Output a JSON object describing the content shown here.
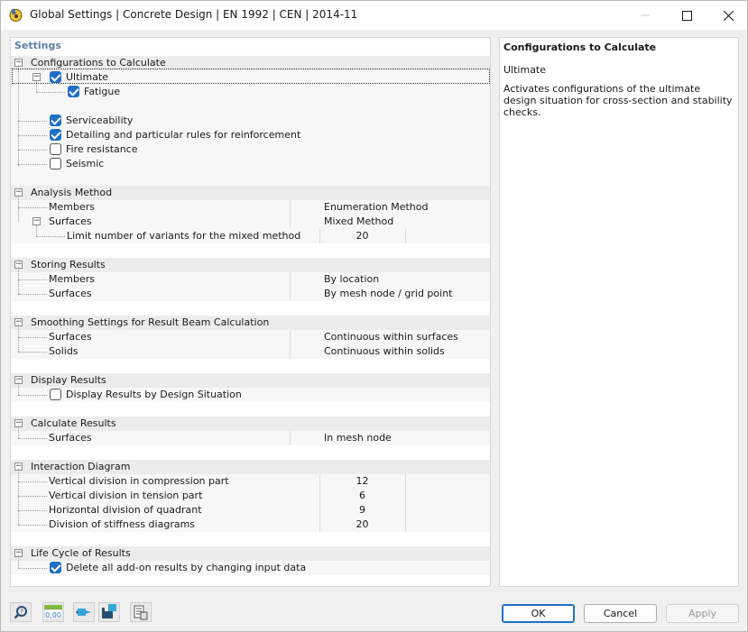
{
  "window": {
    "title": "Global Settings | Concrete Design | EN 1992 | CEN | 2014-11"
  },
  "settings": {
    "header": "Settings",
    "groups": {
      "configurations": {
        "label": "Configurations to Calculate",
        "ultimate": "Ultimate",
        "fatigue": "Fatigue",
        "serviceability": "Serviceability",
        "detailing": "Detailing and particular rules for reinforcement",
        "fire": "Fire resistance",
        "seismic": "Seismic"
      },
      "analysis": {
        "label": "Analysis Method",
        "members": "Members",
        "members_value": "Enumeration Method",
        "surfaces": "Surfaces",
        "surfaces_value": "Mixed Method",
        "limit": "Limit number of variants for the mixed method",
        "limit_value": "20"
      },
      "storing": {
        "label": "Storing Results",
        "members": "Members",
        "members_value": "By location",
        "surfaces": "Surfaces",
        "surfaces_value": "By mesh node / grid point"
      },
      "smoothing": {
        "label": "Smoothing Settings for Result Beam Calculation",
        "surfaces": "Surfaces",
        "surfaces_value": "Continuous within surfaces",
        "solids": "Solids",
        "solids_value": "Continuous within solids"
      },
      "display": {
        "label": "Display Results",
        "by_situation": "Display Results by Design Situation"
      },
      "calculate": {
        "label": "Calculate Results",
        "surfaces": "Surfaces",
        "surfaces_value": "In mesh node"
      },
      "interaction": {
        "label": "Interaction Diagram",
        "vcomp": "Vertical division in compression part",
        "vcomp_value": "12",
        "vtens": "Vertical division in tension part",
        "vtens_value": "6",
        "hquad": "Horizontal division of quadrant",
        "hquad_value": "9",
        "stiff": "Division of stiffness diagrams",
        "stiff_value": "20"
      },
      "lifecycle": {
        "label": "Life Cycle of Results",
        "delete": "Delete all add-on results by changing input data"
      }
    }
  },
  "description": {
    "title": "Configurations to Calculate",
    "subtitle": "Ultimate",
    "body": "Activates configurations of the ultimate design situation for cross-section and stability checks."
  },
  "footer": {
    "ok": "OK",
    "cancel": "Cancel",
    "apply": "Apply",
    "units_icon_text": "0,00"
  },
  "colors": {
    "accent": "#1f6fc5",
    "header_text": "#5a7fa8"
  }
}
